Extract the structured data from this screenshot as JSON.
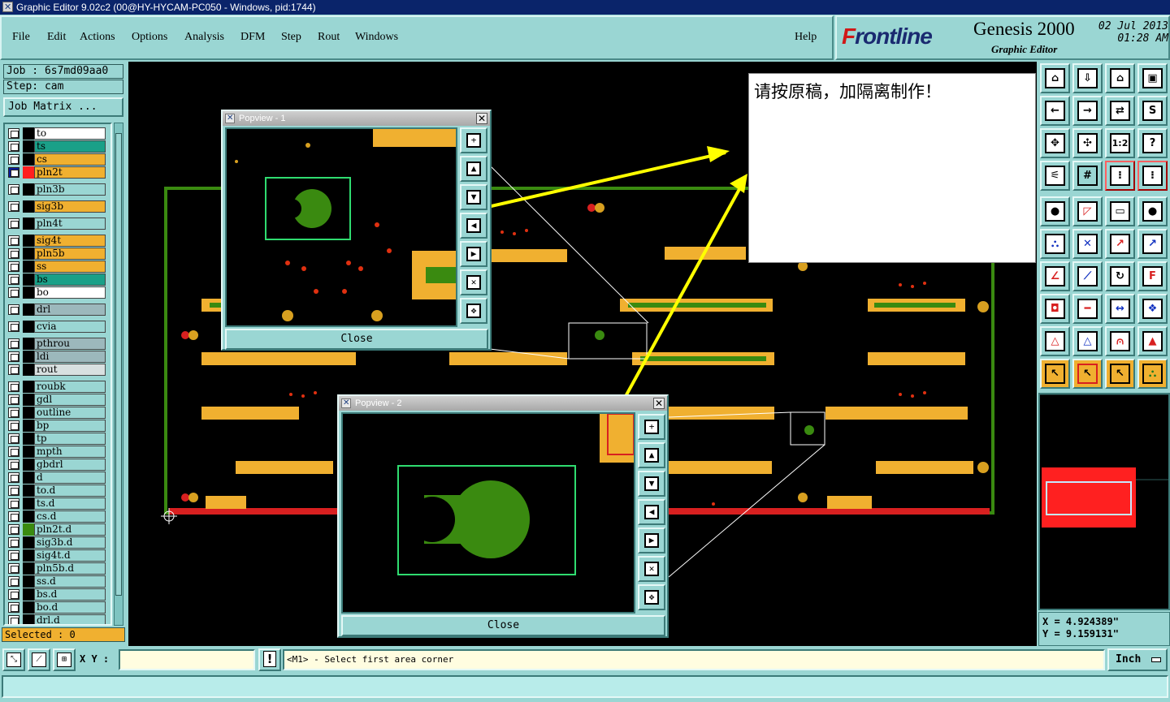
{
  "window": {
    "title": "Graphic Editor 9.02c2 (00@HY-HYCAM-PC050 - Windows, pid:1744)"
  },
  "menu": {
    "items": [
      "File",
      "Edit",
      "Actions",
      "Options",
      "Analysis",
      "DFM",
      "Step",
      "Rout",
      "Windows"
    ],
    "help": "Help"
  },
  "brand": {
    "logo_f": "F",
    "logo_rest": "rontline",
    "product": "Genesis 2000",
    "subtitle": "Graphic Editor",
    "date": "02 Jul 2013",
    "time": "01:28 AM"
  },
  "job": {
    "job_label": "Job : 6s7md09aa0",
    "step_label": "Step: cam",
    "matrix_button": "Job Matrix ..."
  },
  "layers": [
    {
      "name": "to",
      "color": "#ffffff"
    },
    {
      "name": "ts",
      "color": "#1aa088"
    },
    {
      "name": "cs",
      "color": "#f0b030"
    },
    {
      "name": "pln2t",
      "color": "#f0b030",
      "active": true
    },
    {
      "name": "pln3b",
      "color": "#9ad6d3"
    },
    {
      "name": "sig3b",
      "color": "#f0b030"
    },
    {
      "name": "pln4t",
      "color": "#9ad6d3"
    },
    {
      "name": "sig4t",
      "color": "#f0b030"
    },
    {
      "name": "pln5b",
      "color": "#f0b030"
    },
    {
      "name": "ss",
      "color": "#f0b030"
    },
    {
      "name": "bs",
      "color": "#1aa088"
    },
    {
      "name": "bo",
      "color": "#ffffff"
    },
    {
      "name": "drl",
      "color": "#9cb8bc"
    },
    {
      "name": "cvia",
      "color": "#9ad6d3"
    },
    {
      "name": "pthrou",
      "color": "#9cb8bc"
    },
    {
      "name": "ldi",
      "color": "#9cb8bc"
    },
    {
      "name": "rout",
      "color": "#d8e0e0"
    },
    {
      "name": "roubk",
      "color": "#9ad6d3"
    },
    {
      "name": "gdl",
      "color": "#9ad6d3"
    },
    {
      "name": "outline",
      "color": "#9ad6d3"
    },
    {
      "name": "bp",
      "color": "#9ad6d3"
    },
    {
      "name": "tp",
      "color": "#9ad6d3"
    },
    {
      "name": "mpth",
      "color": "#9ad6d3"
    },
    {
      "name": "gbdrl",
      "color": "#9ad6d3"
    },
    {
      "name": "d",
      "color": "#9ad6d3"
    },
    {
      "name": "to.d",
      "color": "#9ad6d3"
    },
    {
      "name": "ts.d",
      "color": "#9ad6d3"
    },
    {
      "name": "cs.d",
      "color": "#9ad6d3"
    },
    {
      "name": "pln2t.d",
      "color": "#9ad6d3",
      "swatch": "#3a8a10"
    },
    {
      "name": "sig3b.d",
      "color": "#9ad6d3"
    },
    {
      "name": "sig4t.d",
      "color": "#9ad6d3"
    },
    {
      "name": "pln5b.d",
      "color": "#9ad6d3"
    },
    {
      "name": "ss.d",
      "color": "#9ad6d3"
    },
    {
      "name": "bs.d",
      "color": "#9ad6d3"
    },
    {
      "name": "bo.d",
      "color": "#9ad6d3"
    },
    {
      "name": "drl.d",
      "color": "#9ad6d3"
    }
  ],
  "selected": "Selected : 0",
  "note": {
    "text": "请按原稿，加隔离制作！"
  },
  "popview1": {
    "title": "Popview - 1",
    "close": "Close"
  },
  "popview2": {
    "title": "Popview - 2",
    "close": "Close"
  },
  "coords": {
    "x": "X = 4.924389\"",
    "y": "Y = 9.159131\""
  },
  "bottom": {
    "xy_label": "X Y :",
    "xy_value": "",
    "warn": "!",
    "prompt": "<M1> - Select first area corner",
    "unit": "Inch"
  },
  "colors": {
    "panel": "#9ad6d3",
    "copper": "#f0b030",
    "pad_green": "#3a8a10",
    "highlight": "#ffff00",
    "outline_red": "#ff2020"
  }
}
